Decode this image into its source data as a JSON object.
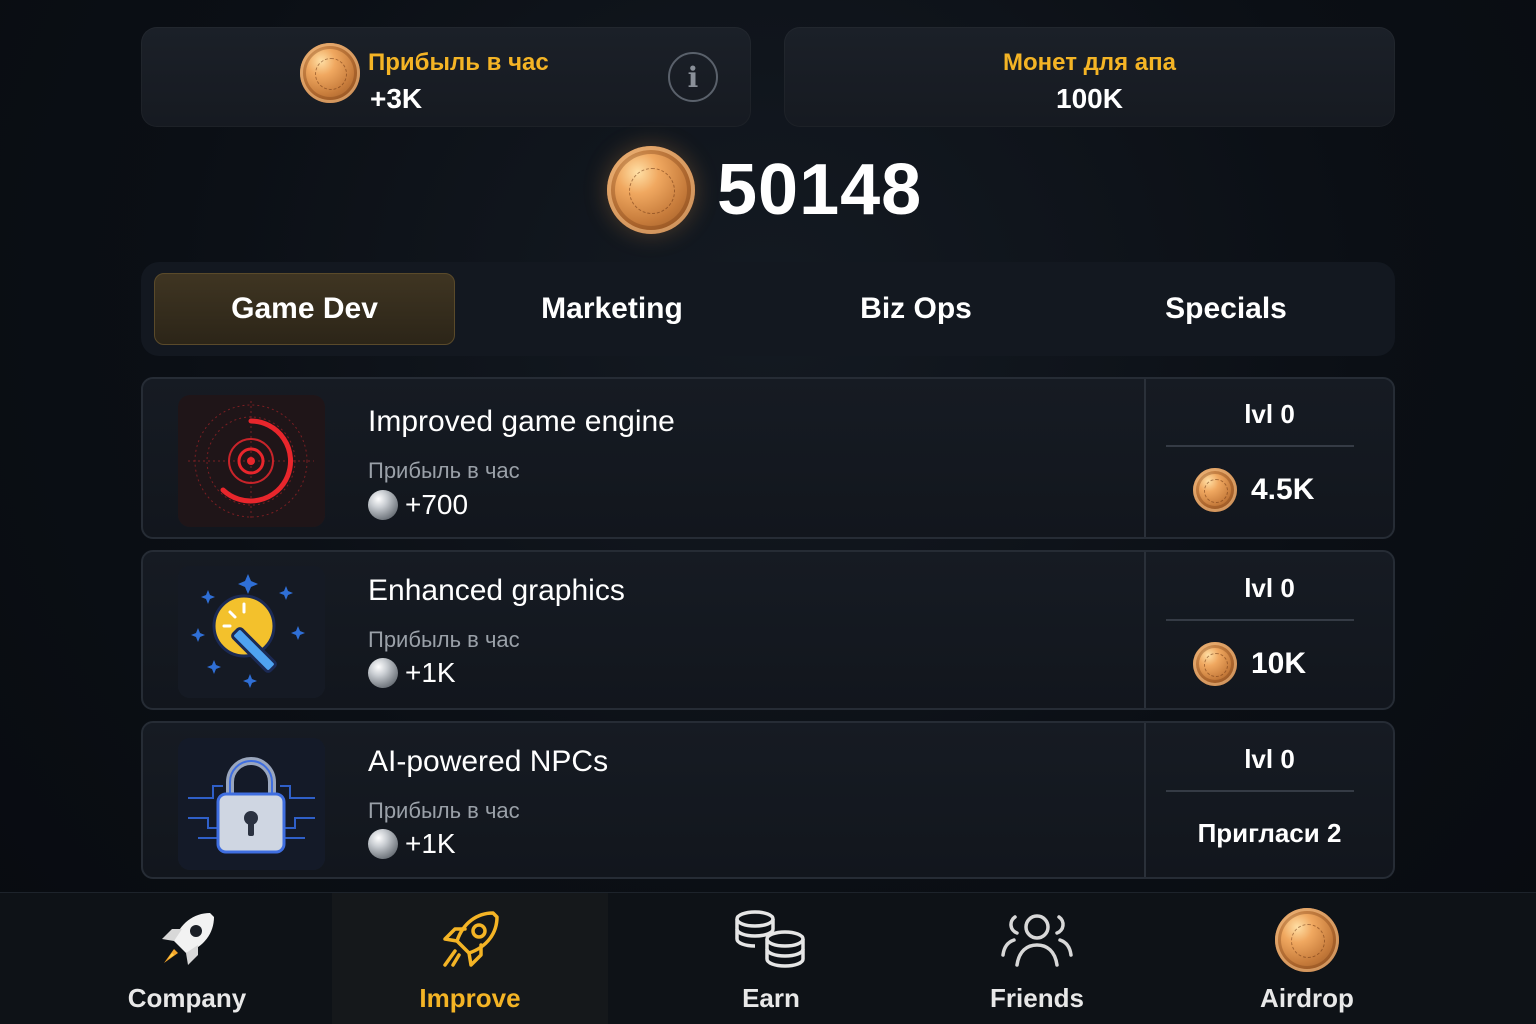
{
  "header": {
    "profit_label": "Прибыль в час",
    "profit_value": "+3K",
    "levelup_label": "Монет для апа",
    "levelup_value": "100K"
  },
  "balance": "50148",
  "tabs": [
    {
      "label": "Game Dev",
      "active": true
    },
    {
      "label": "Marketing",
      "active": false
    },
    {
      "label": "Biz Ops",
      "active": false
    },
    {
      "label": "Specials",
      "active": false
    }
  ],
  "cards": [
    {
      "name": "Improved game engine",
      "profit_label": "Прибыль в час",
      "profit": "+700",
      "level": "lvl 0",
      "price": "4.5K",
      "icon": "target-icon"
    },
    {
      "name": "Enhanced graphics",
      "profit_label": "Прибыль в час",
      "profit": "+1K",
      "level": "lvl 0",
      "price": "10K",
      "icon": "magic-wand-icon"
    },
    {
      "name": "AI-powered NPCs",
      "profit_label": "Прибыль в час",
      "profit": "+1K",
      "level": "lvl 0",
      "requirement": "Пригласи 2",
      "icon": "lock-icon"
    }
  ],
  "nav": [
    {
      "label": "Company",
      "icon": "rocket-icon"
    },
    {
      "label": "Improve",
      "icon": "rocket-outline-icon",
      "active": true
    },
    {
      "label": "Earn",
      "icon": "coins-stack-icon"
    },
    {
      "label": "Friends",
      "icon": "friends-icon"
    },
    {
      "label": "Airdrop",
      "icon": "coin-icon"
    }
  ],
  "colors": {
    "accent": "#f4b425",
    "background": "#0b0f15",
    "card": "#161b23"
  }
}
